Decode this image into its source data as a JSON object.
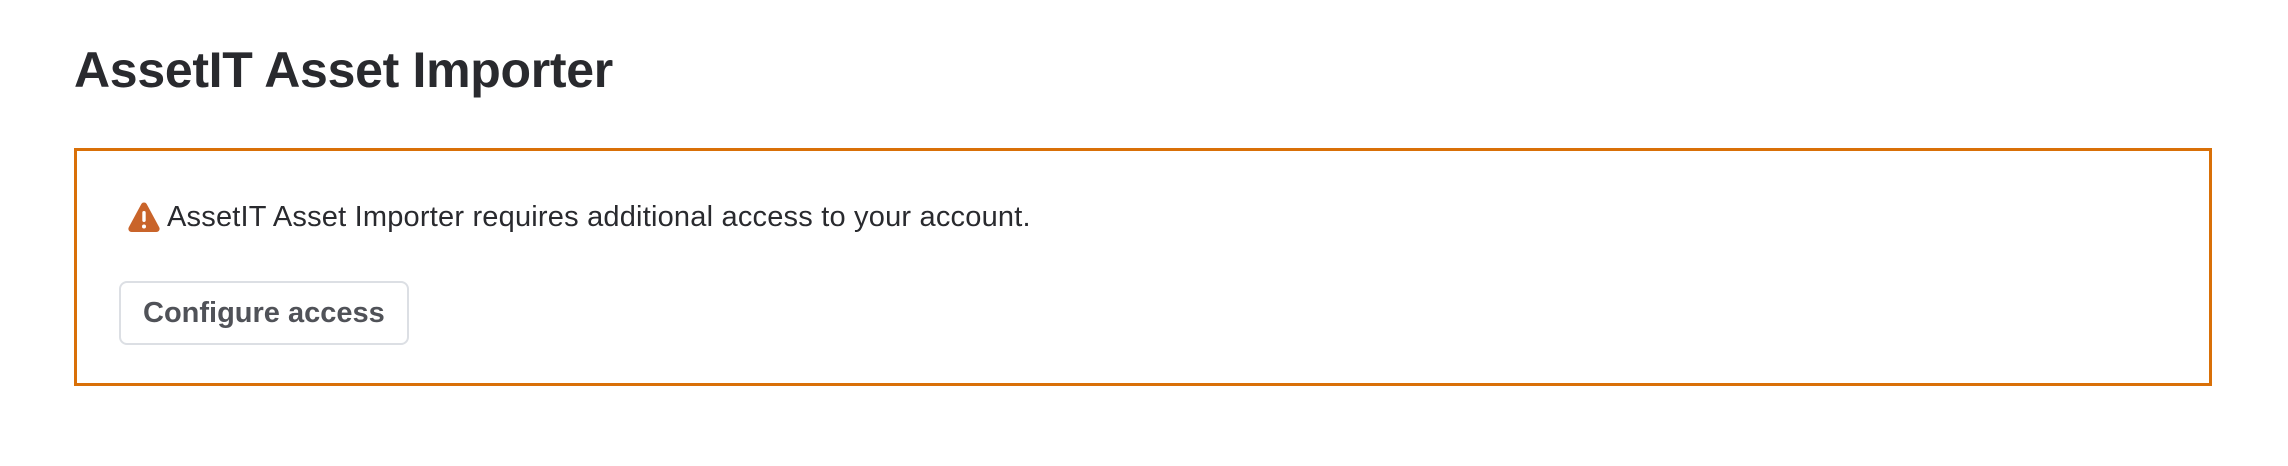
{
  "page": {
    "title": "AssetIT Asset Importer"
  },
  "warning": {
    "icon": "warning-icon",
    "message": "AssetIT Asset Importer requires additional access to your account.",
    "button_label": "Configure access"
  },
  "colors": {
    "warning_border": "#d97008",
    "warning_icon": "#c9642a",
    "title_text": "#292a2e",
    "button_text": "#505258",
    "button_border": "#dcdfe4"
  }
}
